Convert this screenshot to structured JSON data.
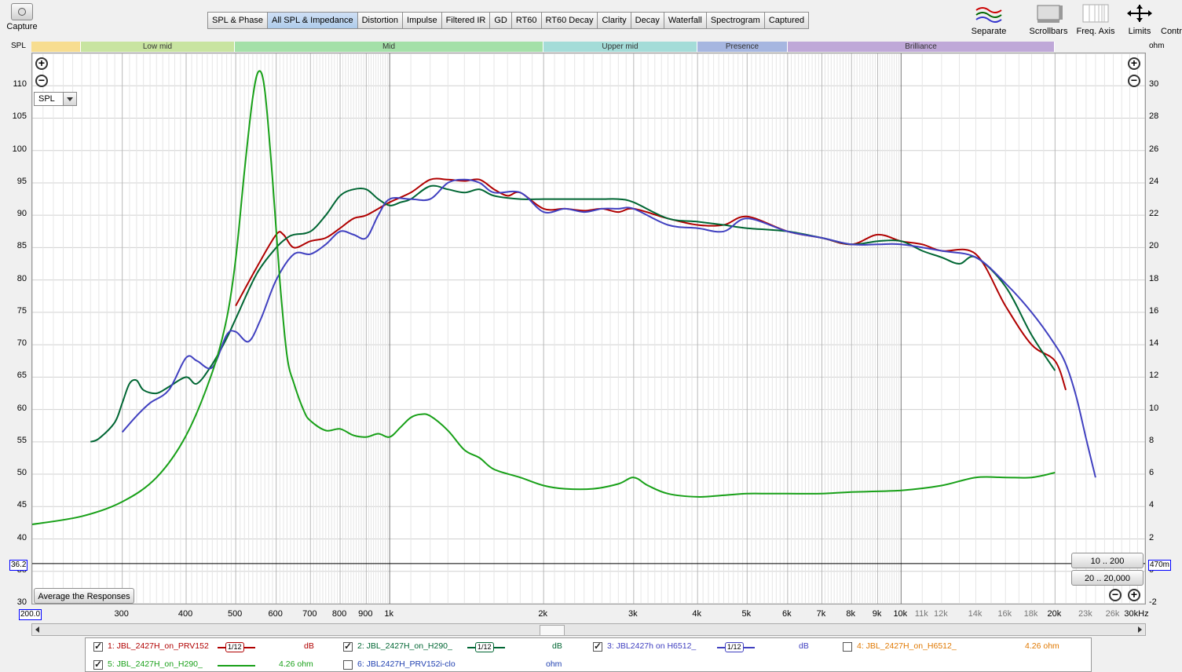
{
  "toolbar": {
    "capture_label": "Capture",
    "tabs": [
      "SPL & Phase",
      "All SPL & Impedance",
      "Distortion",
      "Impulse",
      "Filtered IR",
      "GD",
      "RT60",
      "RT60 Decay",
      "Clarity",
      "Decay",
      "Waterfall",
      "Spectrogram",
      "Captured"
    ],
    "active_tab": "All SPL & Impedance",
    "right_tools": [
      "Separate",
      "Scrollbars",
      "Freq. Axis",
      "Limits",
      "Contr"
    ]
  },
  "bands": [
    "Low mid",
    "Mid",
    "Upper mid",
    "Presence",
    "Brilliance"
  ],
  "axis": {
    "left_title": "SPL",
    "right_title": "ohm",
    "spl_selector": "SPL",
    "y_left_ticks": [
      "110",
      "105",
      "100",
      "95",
      "90",
      "85",
      "80",
      "75",
      "70",
      "65",
      "60",
      "55",
      "50",
      "45",
      "40",
      "35",
      "30"
    ],
    "y_right_ticks": [
      "30",
      "28",
      "26",
      "24",
      "22",
      "20",
      "18",
      "16",
      "14",
      "12",
      "10",
      "8",
      "6",
      "4",
      "2",
      "0",
      "-2"
    ],
    "x_ticks": [
      "300",
      "400",
      "500",
      "600",
      "700",
      "800",
      "900",
      "1k",
      "2k",
      "3k",
      "4k",
      "5k",
      "6k",
      "7k",
      "8k",
      "9k",
      "10k",
      "11k",
      "12k",
      "14k",
      "16k",
      "18k",
      "20k",
      "23k",
      "26k",
      "30kHz"
    ],
    "x_min_label": "200.0",
    "left_cursor_value": "36.2",
    "right_cursor_value": "470m"
  },
  "controls": {
    "average_button": "Average the Responses",
    "range_button_1": "10 .. 200",
    "range_button_2": "20 .. 20,000"
  },
  "legend": [
    {
      "label": "1: JBL_2427H_on_PRV152",
      "checked": true,
      "smoothing": "1/12",
      "unit": "dB",
      "color": "#b00000"
    },
    {
      "label": "2: JBL_2427H_on_H290_",
      "checked": true,
      "smoothing": "1/12",
      "unit": "dB",
      "color": "#006633"
    },
    {
      "label": "3: JBL2427h on H6512_",
      "checked": true,
      "smoothing": "1/12",
      "unit": "dB",
      "color": "#4040c0"
    },
    {
      "label": "4: JBL_2427H_on_H6512_",
      "checked": false,
      "smoothing": "",
      "unit": "4.26 ohm",
      "color": "#e07800"
    },
    {
      "label": "5: JBL_2427H_on_H290_",
      "checked": true,
      "smoothing": "",
      "unit": "4.26 ohm",
      "color": "#18a018"
    },
    {
      "label": "6: JBL2427H_PRV152i-clo",
      "checked": false,
      "smoothing": "",
      "unit": "ohm",
      "color": "#2040b0"
    }
  ],
  "chart_data": {
    "type": "line",
    "xlabel": "",
    "ylabel": "SPL",
    "y2label": "ohm",
    "xscale": "log",
    "xlim": [
      200,
      30000
    ],
    "ylim": [
      30,
      115
    ],
    "y2lim": [
      -2,
      32
    ],
    "grid": true,
    "series": [
      {
        "name": "1: JBL_2427H_on_PRV152",
        "color": "#b00000",
        "axis": "left",
        "x": [
          500,
          550,
          600,
          620,
          650,
          700,
          750,
          800,
          850,
          900,
          1000,
          1100,
          1200,
          1300,
          1400,
          1500,
          1600,
          1700,
          1800,
          2000,
          2200,
          2400,
          2600,
          2800,
          3000,
          3500,
          4000,
          4500,
          5000,
          6000,
          7000,
          8000,
          9000,
          10000,
          11000,
          12000,
          14000,
          16000,
          18000,
          20000,
          21000
        ],
        "y": [
          76,
          82,
          87,
          87,
          85,
          86,
          86.5,
          88,
          89.5,
          90,
          92,
          93.5,
          95.5,
          95.5,
          95.3,
          95.5,
          94,
          93,
          93.5,
          91,
          91,
          90.7,
          91,
          90.5,
          91,
          89.5,
          88.5,
          88.5,
          89.8,
          87.5,
          86.5,
          85.5,
          87,
          86,
          85.5,
          84.5,
          84,
          76,
          70,
          67.5,
          63
        ]
      },
      {
        "name": "2: JBL_2427H_on_H290_",
        "color": "#006633",
        "axis": "left",
        "x": [
          260,
          270,
          290,
          300,
          310,
          320,
          330,
          350,
          370,
          400,
          420,
          450,
          480,
          500,
          550,
          600,
          630,
          650,
          700,
          750,
          800,
          850,
          900,
          950,
          1000,
          1050,
          1100,
          1200,
          1300,
          1400,
          1500,
          1600,
          1800,
          2000,
          2200,
          2400,
          2600,
          2800,
          3000,
          3500,
          4000,
          4500,
          5000,
          6000,
          7000,
          8000,
          9000,
          10000,
          11000,
          12000,
          13000,
          14000,
          16000,
          18000,
          20000
        ],
        "y": [
          55,
          55.5,
          58,
          61,
          64,
          64.5,
          63,
          62.5,
          63.5,
          65,
          64,
          67,
          71,
          74,
          81,
          85,
          86.5,
          87,
          87.5,
          90,
          93,
          94,
          94,
          92.5,
          91.5,
          92,
          92.5,
          94.5,
          94,
          93.5,
          94,
          93,
          92.5,
          92.5,
          92.5,
          92.5,
          92.5,
          92.5,
          92,
          89.5,
          89,
          88.5,
          88,
          87.5,
          86.5,
          85.5,
          86,
          86,
          84.5,
          83.5,
          82.5,
          83.5,
          79,
          71.5,
          66
        ]
      },
      {
        "name": "3: JBL2427h on H6512_",
        "color": "#4040c0",
        "axis": "left",
        "x": [
          300,
          320,
          340,
          370,
          400,
          420,
          450,
          480,
          500,
          530,
          560,
          600,
          650,
          700,
          750,
          800,
          850,
          900,
          950,
          1000,
          1100,
          1200,
          1300,
          1400,
          1500,
          1600,
          1800,
          2000,
          2200,
          2400,
          2600,
          2800,
          3000,
          3500,
          4000,
          4500,
          5000,
          6000,
          7000,
          8000,
          9000,
          10000,
          12000,
          14000,
          16000,
          18000,
          20000,
          21000,
          22000,
          23000,
          24000
        ],
        "y": [
          56.5,
          59,
          61,
          63,
          68,
          67.5,
          66.5,
          71.5,
          72,
          70.5,
          74,
          80,
          84,
          84,
          85.5,
          87.5,
          87,
          86.5,
          90,
          92.5,
          92.5,
          92.5,
          95,
          95.5,
          95,
          93.5,
          93.5,
          90.5,
          91,
          90.5,
          91,
          91,
          91,
          88.5,
          88,
          87.5,
          89.5,
          87.5,
          86.5,
          85.5,
          85.5,
          85.5,
          84.5,
          83.5,
          79.5,
          75,
          70,
          67,
          62,
          55.5,
          49.5
        ]
      },
      {
        "name": "5: JBL_2427H_on_H290_",
        "color": "#18a018",
        "axis": "right",
        "x": [
          200,
          250,
          300,
          350,
          400,
          450,
          480,
          500,
          520,
          540,
          555,
          570,
          590,
          610,
          630,
          650,
          680,
          700,
          750,
          800,
          850,
          900,
          950,
          1000,
          1050,
          1100,
          1150,
          1200,
          1300,
          1400,
          1500,
          1600,
          1800,
          2000,
          2200,
          2500,
          2800,
          3000,
          3200,
          3500,
          4000,
          4500,
          5000,
          5500,
          6000,
          7000,
          8000,
          10000,
          12000,
          14000,
          16000,
          18000,
          20000
        ],
        "y": [
          2.9,
          3.4,
          4.3,
          5.8,
          8.4,
          12.3,
          15.6,
          19.3,
          24.7,
          29.3,
          30.9,
          29.7,
          24.3,
          17.9,
          13.3,
          11.6,
          9.9,
          9.3,
          8.7,
          8.8,
          8.4,
          8.3,
          8.5,
          8.3,
          8.9,
          9.5,
          9.7,
          9.6,
          8.7,
          7.5,
          7.0,
          6.3,
          5.8,
          5.3,
          5.1,
          5.1,
          5.4,
          5.8,
          5.3,
          4.8,
          4.6,
          4.7,
          4.8,
          4.8,
          4.8,
          4.8,
          4.9,
          5.0,
          5.3,
          5.8,
          5.8,
          5.8,
          6.1
        ]
      }
    ]
  }
}
